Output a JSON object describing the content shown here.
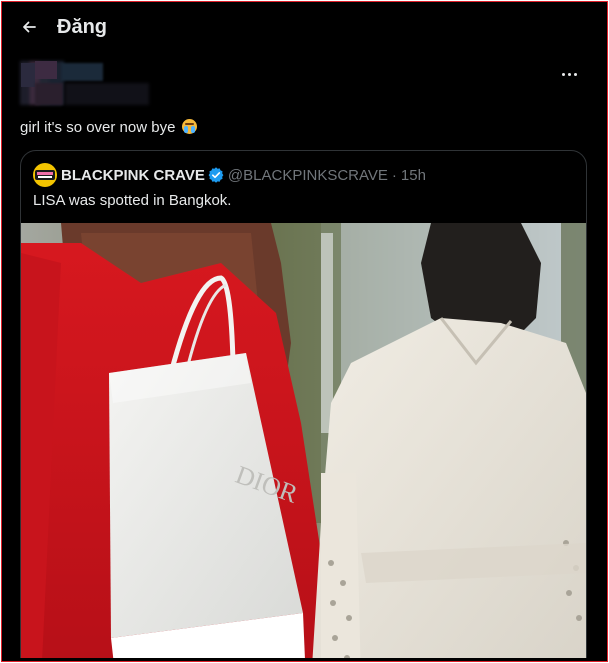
{
  "header": {
    "title": "Đăng",
    "back_icon": "arrow-left-icon"
  },
  "post": {
    "text": "girl it's so over now bye",
    "emoji": "loudly-crying-face-emoji",
    "more_icon": "more-horizontal-icon"
  },
  "quote": {
    "name": "BLACKPINK CRAVE",
    "handle": "@BLACKPINKSCRAVE",
    "separator": "·",
    "time": "15h",
    "text": "LISA was spotted in Bangkok.",
    "verified_icon": "verified-badge-icon",
    "media_brand": "DIOR"
  },
  "colors": {
    "background": "#000000",
    "text_primary": "#e7e9ea",
    "text_secondary": "#71767b",
    "border": "#2f3336",
    "verified": "#1d9bf0",
    "frame_border": "#e0202a"
  }
}
